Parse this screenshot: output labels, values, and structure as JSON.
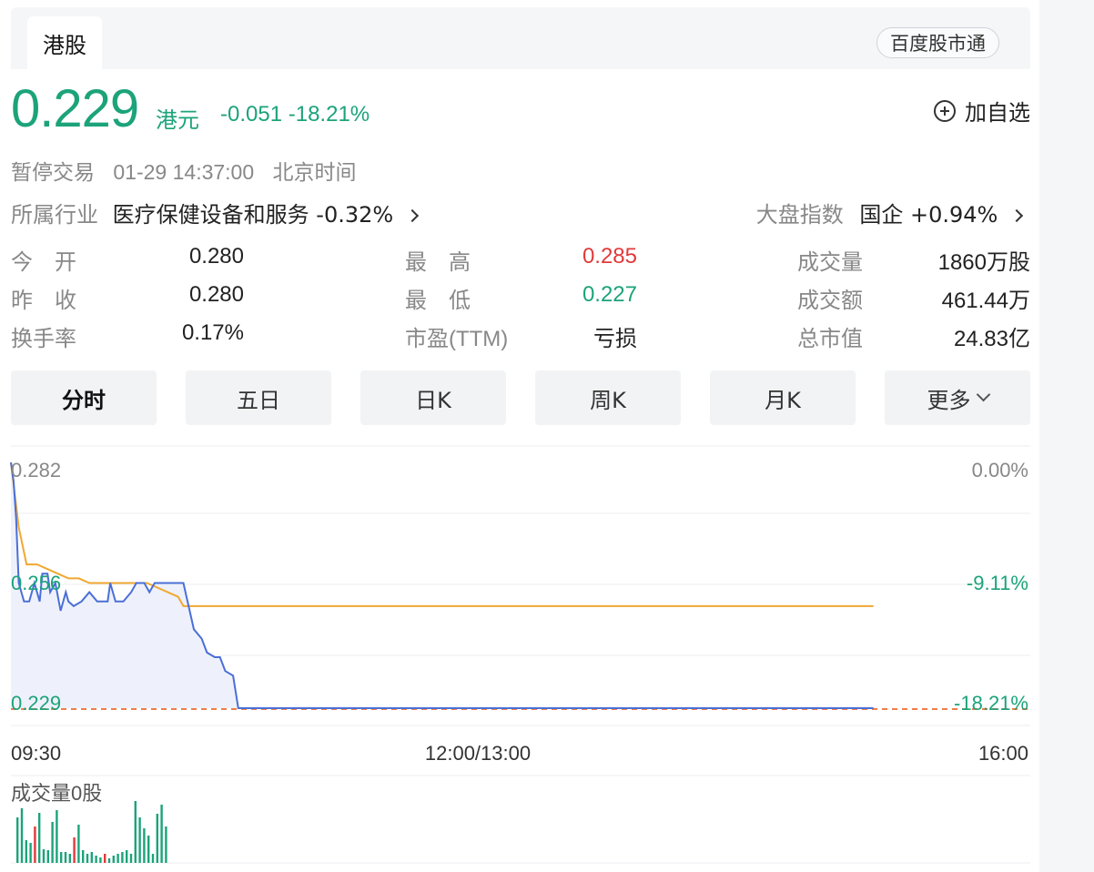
{
  "tabs": {
    "active": "港股",
    "pill": "百度股市通"
  },
  "quote": {
    "price": "0.229",
    "unit": "港元",
    "change": "-0.051",
    "change_pct": "-18.21%",
    "watch_label": "加自选"
  },
  "status": {
    "state": "暂停交易",
    "time": "01-29 14:37:00",
    "tz": "北京时间"
  },
  "industry": {
    "label": "所属行业",
    "name": "医疗保健设备和服务",
    "pct": "-0.32%"
  },
  "index": {
    "label": "大盘指数",
    "name": "国企",
    "pct": "+0.94%"
  },
  "stats": [
    {
      "label": "今　开",
      "value": "0.280",
      "color": "#222222"
    },
    {
      "label": "最　高",
      "value": "0.285",
      "color": "#e03a3a"
    },
    {
      "label": "成交量",
      "value": "1860万股",
      "color": "#222222"
    },
    {
      "label": "昨　收",
      "value": "0.280",
      "color": "#222222"
    },
    {
      "label": "最　低",
      "value": "0.227",
      "color": "#1ca37a"
    },
    {
      "label": "成交额",
      "value": "461.44万",
      "color": "#222222"
    },
    {
      "label": "换手率",
      "value": "0.17%",
      "color": "#222222"
    },
    {
      "label": "市盈(TTM)",
      "value": "亏损",
      "color": "#222222"
    },
    {
      "label": "总市值",
      "value": "24.83亿",
      "color": "#222222"
    }
  ],
  "periods": [
    "分时",
    "五日",
    "日K",
    "周K",
    "月K",
    "更多"
  ],
  "colors": {
    "up": "#e03a3a",
    "down": "#1ca37a",
    "price_line": "#4a6fd6",
    "avg_line": "#f0a832",
    "prev_close": "#f07d4a"
  },
  "chart_data": {
    "type": "line",
    "y_left_ticks": [
      "0.282",
      "0.256",
      "0.229"
    ],
    "y_right_ticks": [
      "0.00%",
      "-9.11%",
      "-18.21%"
    ],
    "x_ticks": [
      "09:30",
      "12:00/13:00",
      "16:00"
    ],
    "ylim": [
      0.229,
      0.282
    ],
    "x_minutes": [
      0,
      1,
      2,
      3,
      5,
      7,
      9,
      11,
      12,
      14,
      15,
      17,
      19,
      21,
      22,
      24,
      27,
      30,
      33,
      36,
      37,
      38,
      39,
      40,
      43,
      46,
      48,
      51,
      53,
      55,
      58,
      61,
      63,
      66,
      70,
      73,
      75,
      78,
      80,
      82,
      85,
      87,
      89,
      91,
      93,
      96,
      99,
      102,
      105,
      108,
      110,
      330
    ],
    "price": [
      0.282,
      0.278,
      0.27,
      0.256,
      0.252,
      0.252,
      0.256,
      0.252,
      0.258,
      0.258,
      0.254,
      0.256,
      0.25,
      0.254,
      0.252,
      0.251,
      0.252,
      0.254,
      0.252,
      0.252,
      0.252,
      0.256,
      0.254,
      0.252,
      0.252,
      0.254,
      0.256,
      0.256,
      0.254,
      0.256,
      0.256,
      0.256,
      0.256,
      0.256,
      0.246,
      0.244,
      0.241,
      0.24,
      0.24,
      0.237,
      0.236,
      0.229,
      0.229,
      0.229,
      0.229,
      0.229,
      0.229,
      0.229,
      0.229,
      0.229,
      0.229,
      0.229
    ],
    "avg_x": [
      0,
      3,
      6,
      10,
      14,
      18,
      22,
      26,
      30,
      35,
      40,
      45,
      48,
      52,
      56,
      60,
      64,
      66,
      330
    ],
    "avg": [
      0.282,
      0.268,
      0.26,
      0.26,
      0.259,
      0.258,
      0.257,
      0.257,
      0.256,
      0.256,
      0.256,
      0.256,
      0.256,
      0.256,
      0.255,
      0.254,
      0.253,
      0.251,
      0.251
    ],
    "volume_label": "成交量0股"
  }
}
